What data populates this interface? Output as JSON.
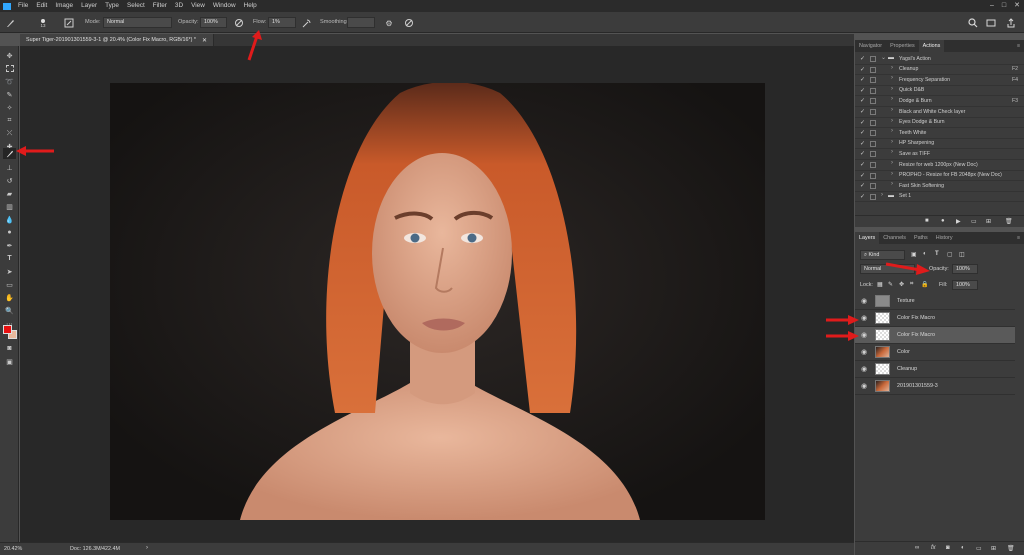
{
  "menu": [
    "File",
    "Edit",
    "Image",
    "Layer",
    "Type",
    "Select",
    "Filter",
    "3D",
    "View",
    "Window",
    "Help"
  ],
  "options": {
    "brush_size": "13",
    "mode_label": "Mode:",
    "mode_value": "Normal",
    "opacity_label": "Opacity:",
    "opacity_value": "100%",
    "flow_label": "Flow:",
    "flow_value": "1%",
    "smoothing_label": "Smoothing:"
  },
  "document": {
    "tab_title": "Super Tiger-201901301559-3-1 @ 20.4% (Color Fix Macro, RGB/16*) *",
    "zoom": "20.42%",
    "doc_info": "Doc: 126.3M/422.4M"
  },
  "top_panel": {
    "tabs": [
      "Navigator",
      "Properties",
      "Actions"
    ],
    "active_tab": "Actions",
    "actions": [
      {
        "label": "Yagsl's Action",
        "key": "",
        "type": "set"
      },
      {
        "label": "Cleanup",
        "key": "F2",
        "type": "action"
      },
      {
        "label": "Frequency Separation",
        "key": "F4",
        "type": "action"
      },
      {
        "label": "Quick D&B",
        "key": "",
        "type": "action"
      },
      {
        "label": "Dodge & Burn",
        "key": "F3",
        "type": "action"
      },
      {
        "label": "Black and White Check layer",
        "key": "",
        "type": "action"
      },
      {
        "label": "Eyes Dodge & Burn",
        "key": "",
        "type": "action"
      },
      {
        "label": "Teeth White",
        "key": "",
        "type": "action"
      },
      {
        "label": "HP Sharpening",
        "key": "",
        "type": "action"
      },
      {
        "label": "Save as TIFF",
        "key": "",
        "type": "action"
      },
      {
        "label": "Resize for web 1200px (New Doc)",
        "key": "",
        "type": "action"
      },
      {
        "label": "PROPHO - Resize for FB 2048px (New Doc)",
        "key": "",
        "type": "action"
      },
      {
        "label": "Fast Skin Softening",
        "key": "",
        "type": "action"
      },
      {
        "label": "Set 1",
        "key": "",
        "type": "set"
      }
    ]
  },
  "layers_panel": {
    "tabs": [
      "Layers",
      "Channels",
      "Paths",
      "History"
    ],
    "active_tab": "Layers",
    "filter_kind": "Kind",
    "blend_mode": "Normal",
    "opacity_label": "Opacity:",
    "opacity_value": "100%",
    "lock_label": "Lock:",
    "fill_label": "Fill:",
    "fill_value": "100%",
    "layers": [
      {
        "name": "Texture",
        "thumb": "gray"
      },
      {
        "name": "Color Fix Macro",
        "thumb": "checker"
      },
      {
        "name": "Color Fix Macro",
        "thumb": "checker",
        "selected": true
      },
      {
        "name": "Color",
        "thumb": "photo"
      },
      {
        "name": "Cleanup",
        "thumb": "checker"
      },
      {
        "name": "201901301559-3",
        "thumb": "photo"
      }
    ]
  },
  "colors": {
    "foreground": "#e81010",
    "background": "#e8b89c",
    "accent_blue": "#31a8ff",
    "arrow_red": "#e01b1b"
  }
}
